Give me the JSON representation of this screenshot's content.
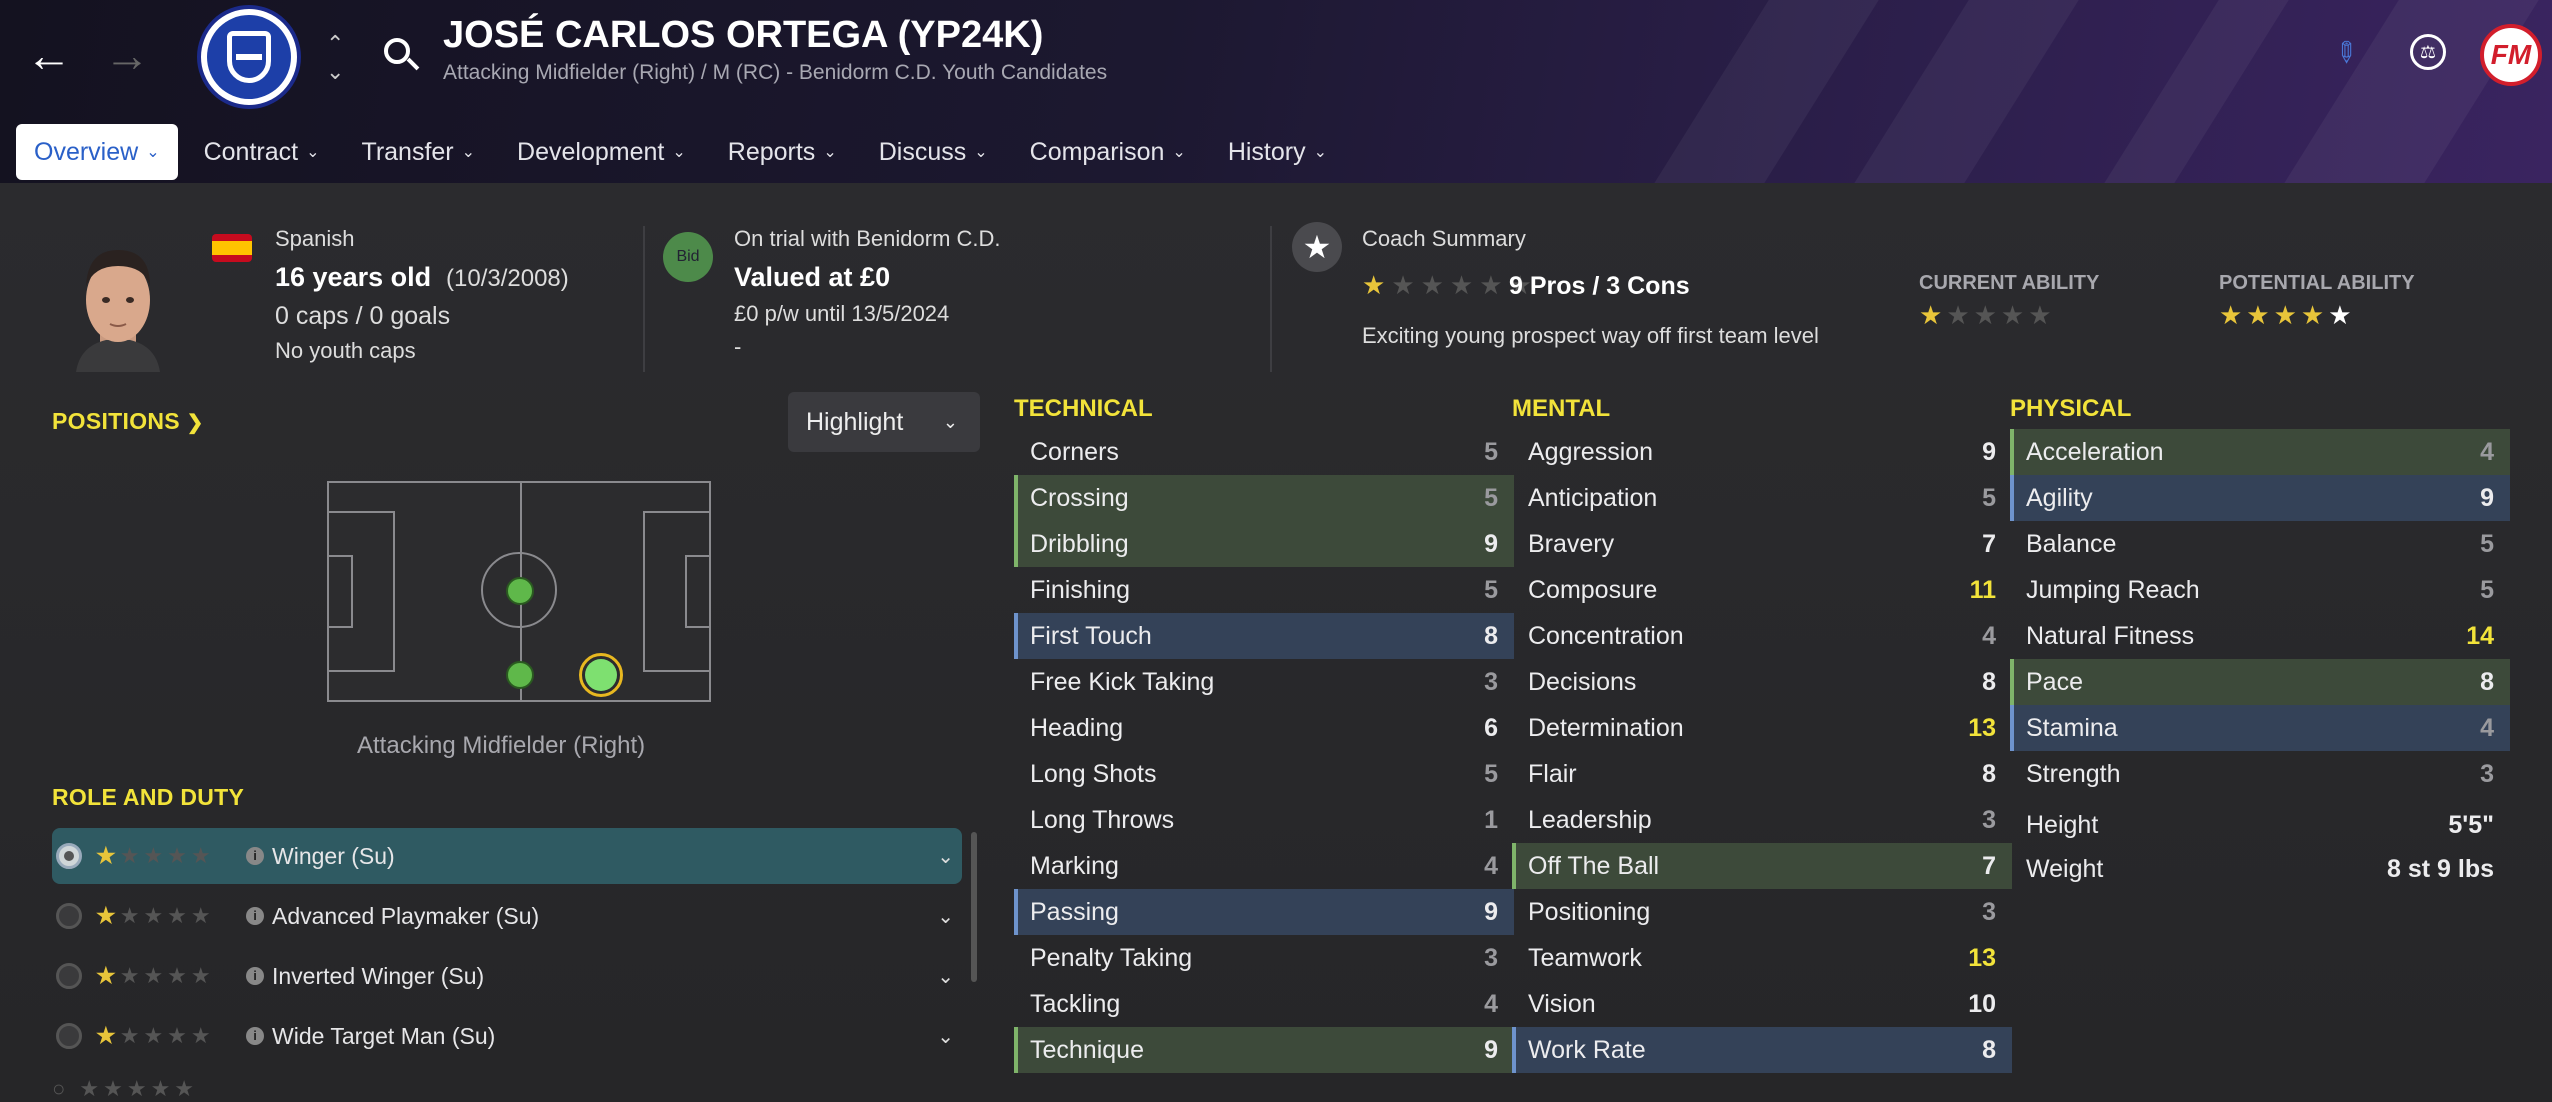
{
  "header": {
    "title": "JOSÉ CARLOS ORTEGA (YP24K)",
    "subtitle": "Attacking Midfielder (Right) / M (RC) - Benidorm C.D. Youth Candidates",
    "logo_text": "FM"
  },
  "tabs": [
    {
      "label": "Overview"
    },
    {
      "label": "Contract"
    },
    {
      "label": "Transfer"
    },
    {
      "label": "Development"
    },
    {
      "label": "Reports"
    },
    {
      "label": "Discuss"
    },
    {
      "label": "Comparison"
    },
    {
      "label": "History"
    }
  ],
  "player": {
    "nationality": "Spanish",
    "age": "16 years old",
    "dob": "(10/3/2008)",
    "caps": "0 caps / 0 goals",
    "youth_caps": "No youth caps"
  },
  "contract": {
    "badge": "Bid",
    "status": "On trial with Benidorm C.D.",
    "value": "Valued at £0",
    "wage": "£0 p/w until 13/5/2024",
    "extra": "-"
  },
  "coach": {
    "title": "Coach Summary",
    "pros_cons": "9 Pros / 3 Cons",
    "summary": "Exciting young prospect way off first team level",
    "current_ability_label": "CURRENT ABILITY",
    "potential_ability_label": "POTENTIAL ABILITY",
    "current_ability_stars": 0.5,
    "potential_ability_stars": 4.5
  },
  "positions": {
    "label": "POSITIONS",
    "highlight": "Highlight",
    "position_name": "Attacking Midfielder (Right)"
  },
  "role_duty": {
    "label": "ROLE AND DUTY",
    "roles": [
      {
        "name": "Winger (Su)",
        "stars": 0.5,
        "selected": true
      },
      {
        "name": "Advanced Playmaker (Su)",
        "stars": 0.5,
        "selected": false
      },
      {
        "name": "Inverted Winger (Su)",
        "stars": 0.5,
        "selected": false
      },
      {
        "name": "Wide Target Man (Su)",
        "stars": 0.5,
        "selected": false
      }
    ]
  },
  "technical": {
    "label": "TECHNICAL",
    "attrs": [
      {
        "name": "Corners",
        "value": "5",
        "hl": "",
        "vc": "d"
      },
      {
        "name": "Crossing",
        "value": "5",
        "hl": "g",
        "vc": "d"
      },
      {
        "name": "Dribbling",
        "value": "9",
        "hl": "g",
        "vc": ""
      },
      {
        "name": "Finishing",
        "value": "5",
        "hl": "",
        "vc": "d"
      },
      {
        "name": "First Touch",
        "value": "8",
        "hl": "b",
        "vc": ""
      },
      {
        "name": "Free Kick Taking",
        "value": "3",
        "hl": "",
        "vc": "d"
      },
      {
        "name": "Heading",
        "value": "6",
        "hl": "",
        "vc": ""
      },
      {
        "name": "Long Shots",
        "value": "5",
        "hl": "",
        "vc": "d"
      },
      {
        "name": "Long Throws",
        "value": "1",
        "hl": "",
        "vc": "d"
      },
      {
        "name": "Marking",
        "value": "4",
        "hl": "",
        "vc": "d"
      },
      {
        "name": "Passing",
        "value": "9",
        "hl": "b",
        "vc": ""
      },
      {
        "name": "Penalty Taking",
        "value": "3",
        "hl": "",
        "vc": "d"
      },
      {
        "name": "Tackling",
        "value": "4",
        "hl": "",
        "vc": "d"
      },
      {
        "name": "Technique",
        "value": "9",
        "hl": "g",
        "vc": ""
      }
    ]
  },
  "mental": {
    "label": "MENTAL",
    "attrs": [
      {
        "name": "Aggression",
        "value": "9",
        "hl": "",
        "vc": ""
      },
      {
        "name": "Anticipation",
        "value": "5",
        "hl": "",
        "vc": "d"
      },
      {
        "name": "Bravery",
        "value": "7",
        "hl": "",
        "vc": ""
      },
      {
        "name": "Composure",
        "value": "11",
        "hl": "",
        "vc": "y"
      },
      {
        "name": "Concentration",
        "value": "4",
        "hl": "",
        "vc": "d"
      },
      {
        "name": "Decisions",
        "value": "8",
        "hl": "",
        "vc": ""
      },
      {
        "name": "Determination",
        "value": "13",
        "hl": "",
        "vc": "y"
      },
      {
        "name": "Flair",
        "value": "8",
        "hl": "",
        "vc": ""
      },
      {
        "name": "Leadership",
        "value": "3",
        "hl": "",
        "vc": "d"
      },
      {
        "name": "Off The Ball",
        "value": "7",
        "hl": "g",
        "vc": ""
      },
      {
        "name": "Positioning",
        "value": "3",
        "hl": "",
        "vc": "d"
      },
      {
        "name": "Teamwork",
        "value": "13",
        "hl": "",
        "vc": "y"
      },
      {
        "name": "Vision",
        "value": "10",
        "hl": "",
        "vc": ""
      },
      {
        "name": "Work Rate",
        "value": "8",
        "hl": "b",
        "vc": ""
      }
    ]
  },
  "physical": {
    "label": "PHYSICAL",
    "attrs": [
      {
        "name": "Acceleration",
        "value": "4",
        "hl": "g",
        "vc": "d"
      },
      {
        "name": "Agility",
        "value": "9",
        "hl": "b",
        "vc": ""
      },
      {
        "name": "Balance",
        "value": "5",
        "hl": "",
        "vc": "d"
      },
      {
        "name": "Jumping Reach",
        "value": "5",
        "hl": "",
        "vc": "d"
      },
      {
        "name": "Natural Fitness",
        "value": "14",
        "hl": "",
        "vc": "y"
      },
      {
        "name": "Pace",
        "value": "8",
        "hl": "g",
        "vc": ""
      },
      {
        "name": "Stamina",
        "value": "4",
        "hl": "b",
        "vc": "d"
      },
      {
        "name": "Strength",
        "value": "3",
        "hl": "",
        "vc": "d"
      }
    ],
    "height_label": "Height",
    "height": "5'5\"",
    "weight_label": "Weight",
    "weight": "8 st 9 lbs"
  },
  "colors": {
    "accent_yellow": "#f2e33a",
    "highlight_green": "#3d4a3a",
    "highlight_blue": "#344258",
    "tab_active": "#2a60c8"
  }
}
